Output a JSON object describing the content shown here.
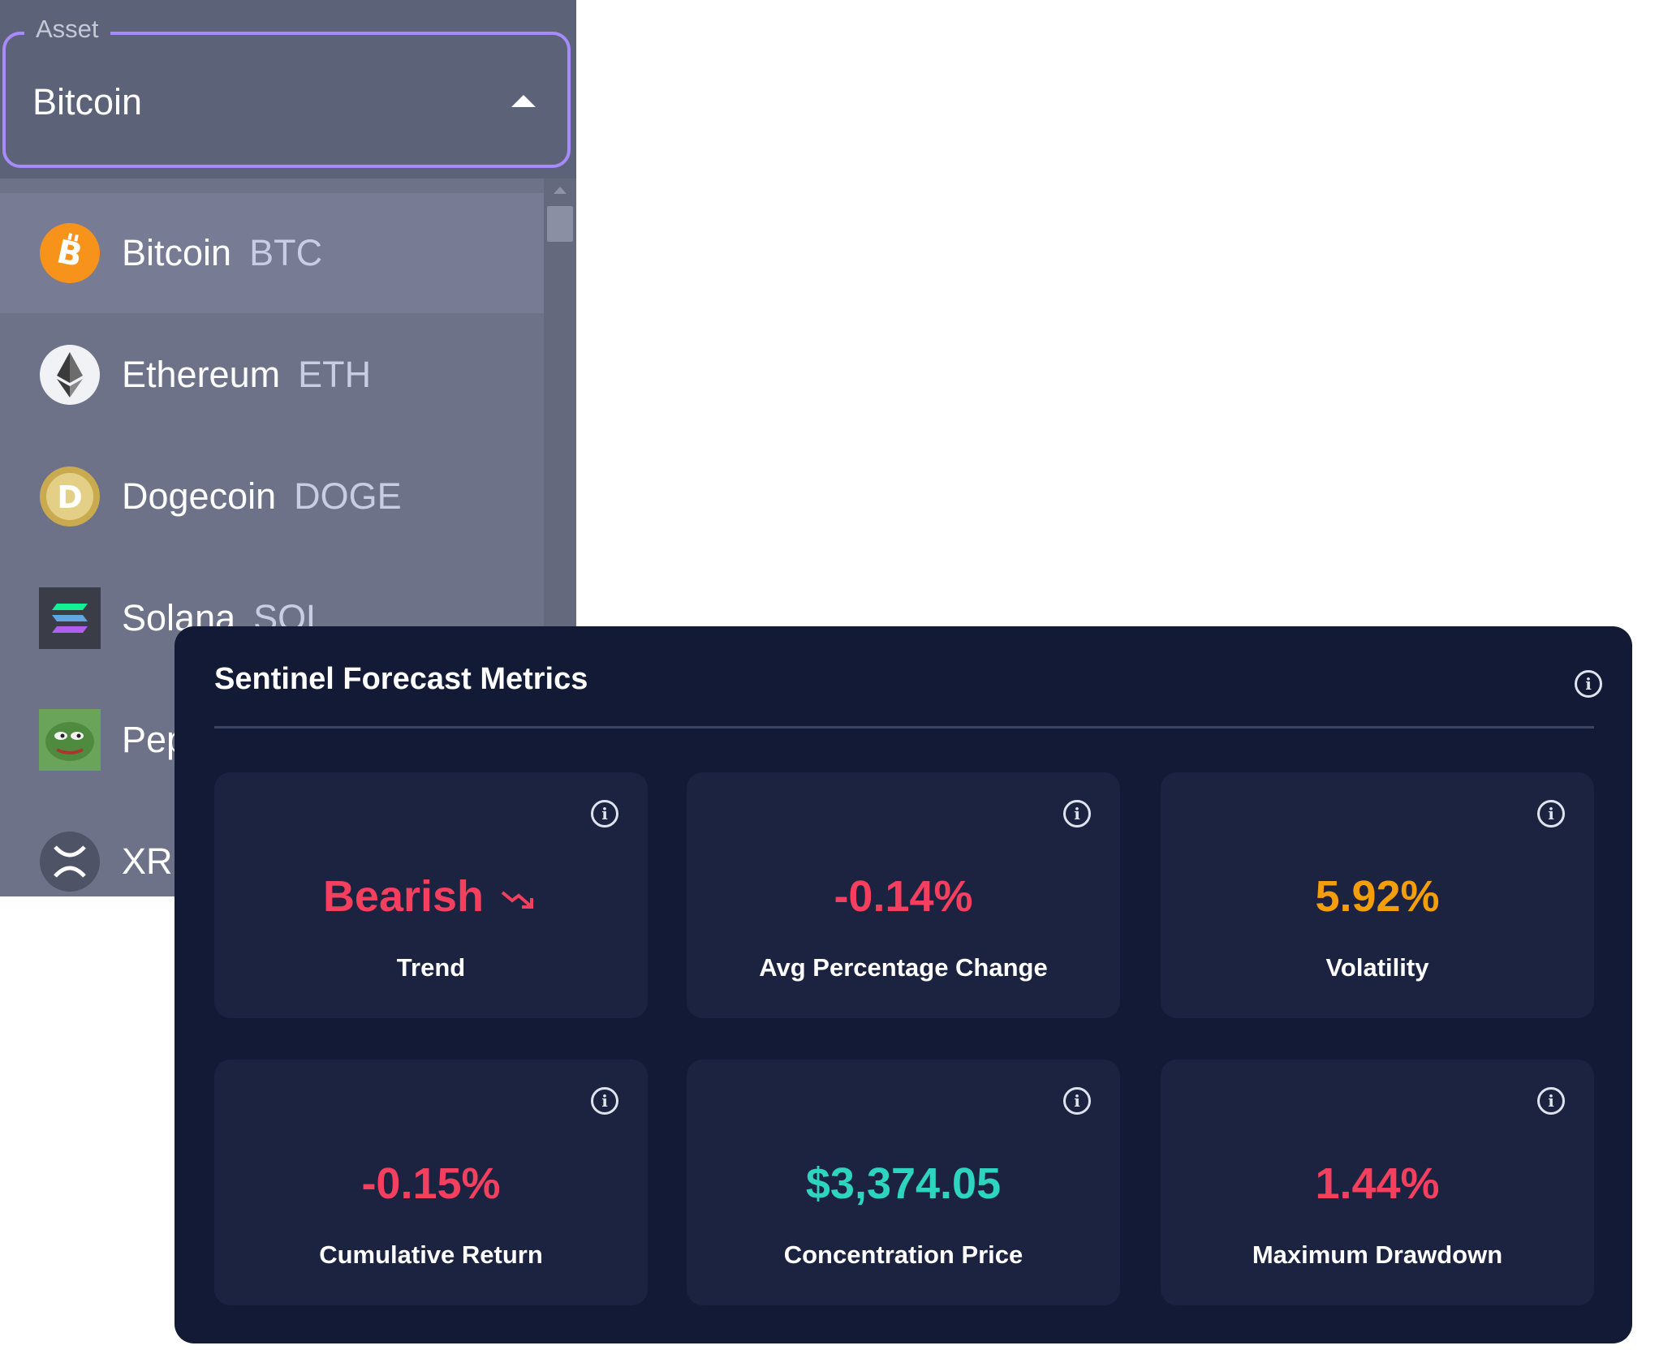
{
  "asset_select": {
    "label": "Asset",
    "value": "Bitcoin",
    "options": [
      {
        "name": "Bitcoin",
        "symbol": "BTC",
        "icon": "bitcoin-icon",
        "selected": true
      },
      {
        "name": "Ethereum",
        "symbol": "ETH",
        "icon": "ethereum-icon"
      },
      {
        "name": "Dogecoin",
        "symbol": "DOGE",
        "icon": "dogecoin-icon"
      },
      {
        "name": "Solana",
        "symbol": "SOL",
        "icon": "solana-icon"
      },
      {
        "name": "Pep",
        "symbol": "",
        "icon": "pepe-icon"
      },
      {
        "name": "XRP",
        "symbol": "",
        "icon": "xrp-icon"
      }
    ]
  },
  "metrics": {
    "title": "Sentinel Forecast Metrics",
    "tiles": [
      {
        "value": "Bearish",
        "label": "Trend",
        "color": "#f43f5e",
        "icon": "trending-down-icon"
      },
      {
        "value": "-0.14%",
        "label": "Avg Percentage Change",
        "color": "#f43f5e"
      },
      {
        "value": "5.92%",
        "label": "Volatility",
        "color": "#f59e0b"
      },
      {
        "value": "-0.15%",
        "label": "Cumulative Return",
        "color": "#f43f5e"
      },
      {
        "value": "$3,374.05",
        "label": "Concentration Price",
        "color": "#2dd4bf"
      },
      {
        "value": "1.44%",
        "label": "Maximum Drawdown",
        "color": "#f43f5e"
      }
    ]
  },
  "colors": {
    "accent_border": "#a78bfa",
    "panel_bg": "#5c6278",
    "card_bg": "#121a36",
    "tile_bg": "#1b2340"
  }
}
